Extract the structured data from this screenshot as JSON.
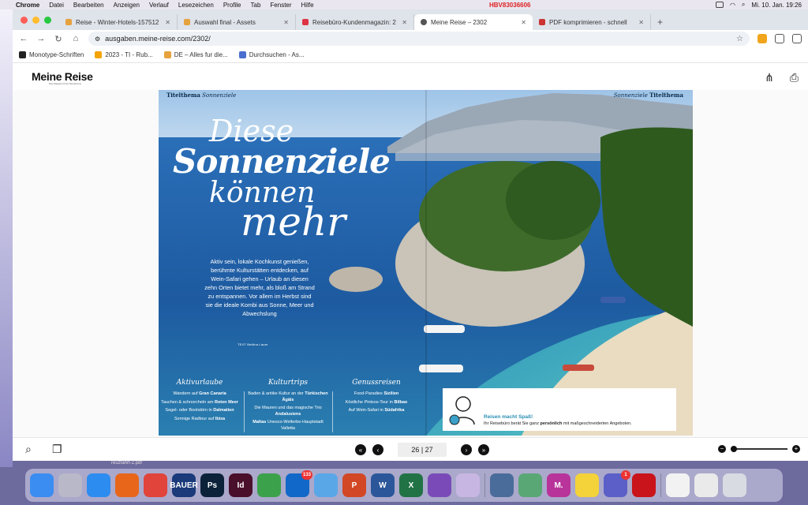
{
  "menubar": {
    "app": "Chrome",
    "items": [
      "Datei",
      "Bearbeiten",
      "Anzeigen",
      "Verlauf",
      "Lesezeichen",
      "Profile",
      "Tab",
      "Fenster",
      "Hilfe"
    ],
    "alert": "HBV83036606",
    "clock": "Mi. 10. Jan.  19:26"
  },
  "tabs": [
    {
      "title": "Reise - Winter-Hotels-157512",
      "favicon_color": "#e6a23c"
    },
    {
      "title": "Auswahl final - Assets",
      "favicon_color": "#e6a23c"
    },
    {
      "title": "Reisebüro-Kundenmagazin: 2",
      "favicon_color": "#d34"
    },
    {
      "title": "Meine Reise – 2302",
      "favicon_color": "#555",
      "active": true
    },
    {
      "title": "PDF komprimieren - schnell",
      "favicon_color": "#c33"
    }
  ],
  "address": {
    "url": "ausgaben.meine-reise.com/2302/"
  },
  "bookmarks": [
    {
      "label": "Monotype-Schriften",
      "color": "#222"
    },
    {
      "label": "2023 - TI - Rub...",
      "color": "#f4a300"
    },
    {
      "label": "DE – Alles fur die...",
      "color": "#e6a23c"
    },
    {
      "label": "Durchsuchen - As...",
      "color": "#4a6fd1"
    }
  ],
  "site": {
    "logo": "Meine Reise",
    "logo_sub": "Das Magazin Ihres Reisebüros"
  },
  "spread": {
    "rubric_left_bold": "Titelthema",
    "rubric_left_italic": " Sonnenziele",
    "rubric_right_italic": "Sonnenziele ",
    "rubric_right_bold": "Titelthema",
    "headline": {
      "line1": "Diese",
      "line2": "Sonnenziele",
      "line3": "können",
      "line4": "mehr"
    },
    "intro": "Aktiv sein, lokale Kochkunst genießen, berühmte Kulturstätten entdecken, auf Wein-Safari gehen – Urlaub an diesen zehn Orten bietet mehr, als bloß am Strand zu entspannen. Vor allem im Herbst sind sie die ideale Kombi aus Sonne, Meer und Abwechslung",
    "byline": "TEXT Bettina Lauer",
    "columns": [
      {
        "head": "Aktivurlaube",
        "items": [
          {
            "pre": "Wandern auf ",
            "bold": "Gran Canaria",
            "post": ""
          },
          {
            "pre": "Tauchen & schnorcheln am ",
            "bold": "Roten Meer",
            "post": ""
          },
          {
            "pre": "Segel- oder Bootstörn in ",
            "bold": "Dalmatien",
            "post": ""
          },
          {
            "pre": "Sonnige Radtour auf ",
            "bold": "Ibiza",
            "post": ""
          }
        ]
      },
      {
        "head": "Kulturtrips",
        "items": [
          {
            "pre": "Baden & antike Kultur an der ",
            "bold": "Türkischen Ägäis",
            "post": ""
          },
          {
            "pre": "Die Mauren und das magische Trio ",
            "bold": "Andalusiens",
            "post": ""
          },
          {
            "pre": "",
            "bold": "Maltas",
            "post": " Unesco-Welterbe-Hauptstadt Valletta"
          }
        ]
      },
      {
        "head": "Genussreisen",
        "items": [
          {
            "pre": "Food-Paradies ",
            "bold": "Sizilien",
            "post": ""
          },
          {
            "pre": "Köstliche Pintxos-Tour in ",
            "bold": "Bilbao",
            "post": ""
          },
          {
            "pre": "Auf Wein-Safari in ",
            "bold": "Südafrika",
            "post": ""
          }
        ]
      }
    ],
    "promo": {
      "title": "Reisen macht Spaß!",
      "text_pre": "Ihr Reisebüro berät Sie ganz ",
      "text_bold": "persönlich",
      "text_post": " mit maßgeschneiderten Angeboten."
    }
  },
  "viewer": {
    "page_display": "26 | 27",
    "zoom_level": 0.05
  },
  "dock": {
    "file_label": "reuzfahrt-2.pdf",
    "apps": [
      {
        "name": "finder",
        "color": "#3b8df1",
        "label": ""
      },
      {
        "name": "launchpad",
        "color": "#b8b8c8",
        "label": ""
      },
      {
        "name": "safari",
        "color": "#2d8cf0",
        "label": ""
      },
      {
        "name": "firefox",
        "color": "#e8661a",
        "label": ""
      },
      {
        "name": "chrome",
        "color": "#e0443a",
        "label": ""
      },
      {
        "name": "bauer",
        "color": "#1a3a7a",
        "label": "BAUER"
      },
      {
        "name": "photoshop",
        "color": "#0b2239",
        "label": "Ps"
      },
      {
        "name": "indesign",
        "color": "#4a0f2a",
        "label": "Id"
      },
      {
        "name": "sketch",
        "color": "#3ca14b",
        "label": ""
      },
      {
        "name": "outlook",
        "color": "#1168c8",
        "label": "",
        "badge": "133"
      },
      {
        "name": "onedrive",
        "color": "#5aa7e8",
        "label": ""
      },
      {
        "name": "powerpoint",
        "color": "#d24726",
        "label": "P"
      },
      {
        "name": "word",
        "color": "#2b579a",
        "label": "W"
      },
      {
        "name": "excel",
        "color": "#217346",
        "label": "X"
      },
      {
        "name": "app-colorful",
        "color": "#7a4bb8",
        "label": ""
      },
      {
        "name": "app-circles",
        "color": "#c8b6e2",
        "label": ""
      },
      {
        "name": "network",
        "color": "#4a6c9a",
        "label": ""
      },
      {
        "name": "keychain",
        "color": "#5aa776",
        "label": ""
      },
      {
        "name": "m-app",
        "color": "#b8349a",
        "label": "M."
      },
      {
        "name": "notes",
        "color": "#f3d23a",
        "label": ""
      },
      {
        "name": "teams",
        "color": "#5b5fc7",
        "label": "",
        "badge": "1"
      },
      {
        "name": "acrobat",
        "color": "#c8141a",
        "label": ""
      },
      {
        "name": "preview-1",
        "color": "#f2f2f2",
        "label": ""
      },
      {
        "name": "preview-2",
        "color": "#eaeaea",
        "label": ""
      },
      {
        "name": "trash",
        "color": "#d8dbe2",
        "label": ""
      }
    ]
  }
}
